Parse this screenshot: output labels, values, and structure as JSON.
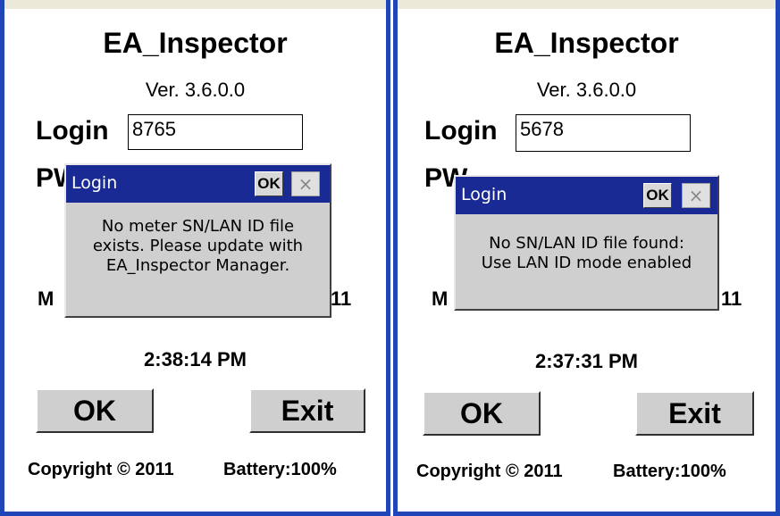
{
  "screens": [
    {
      "app_title": "EA_Inspector",
      "version": "Ver. 3.6.0.0",
      "login_label": "Login",
      "login_value": "8765",
      "pw_label_partial": "P",
      "pw_label_partial2": "W",
      "hidden_left_text": "M",
      "hidden_right_text": "11",
      "time": "2:38:14 PM",
      "ok_button": "OK",
      "exit_button": "Exit",
      "copyright": "Copyright © 2011",
      "battery": "Battery:100%",
      "dialog": {
        "title": "Login",
        "ok": "OK",
        "close": "×",
        "message_lines": [
          "No meter SN/LAN ID file",
          "exists. Please update with",
          "EA_Inspector Manager."
        ]
      }
    },
    {
      "app_title": "EA_Inspector",
      "version": "Ver. 3.6.0.0",
      "login_label": "Login",
      "login_value": "5678",
      "pw_label_partial": "P",
      "pw_label_partial2": "W",
      "hidden_left_text": "M",
      "hidden_right_text": "11",
      "time": "2:37:31 PM",
      "ok_button": "OK",
      "exit_button": "Exit",
      "copyright": "Copyright © 2011",
      "battery": "Battery:100%",
      "dialog": {
        "title": "Login",
        "ok": "OK",
        "close": "×",
        "message_lines": [
          "No SN/LAN ID file found:",
          "Use LAN ID mode enabled"
        ]
      }
    }
  ]
}
